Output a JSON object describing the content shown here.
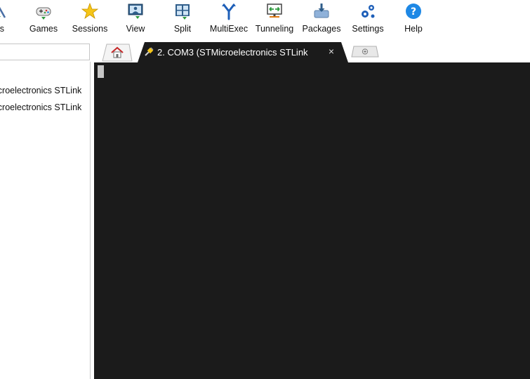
{
  "toolbar": {
    "items": [
      {
        "label": "ols",
        "icon": "tools-icon"
      },
      {
        "label": "Games",
        "icon": "gamepad-icon"
      },
      {
        "label": "Sessions",
        "icon": "star-icon"
      },
      {
        "label": "View",
        "icon": "view-icon"
      },
      {
        "label": "Split",
        "icon": "split-icon"
      },
      {
        "label": "MultiExec",
        "icon": "multiexec-icon"
      },
      {
        "label": "Tunneling",
        "icon": "tunneling-icon"
      },
      {
        "label": "Packages",
        "icon": "packages-icon"
      },
      {
        "label": "Settings",
        "icon": "gears-icon"
      },
      {
        "label": "Help",
        "icon": "help-icon"
      }
    ]
  },
  "sidebar": {
    "search": {
      "value": "",
      "placeholder": ""
    },
    "items": [
      {
        "label": "icroelectronics STLink"
      },
      {
        "label": "icroelectronics STLink"
      }
    ]
  },
  "tabs": {
    "home": {
      "icon": "home-icon"
    },
    "active": {
      "label": "2.  COM3   (STMicroelectronics STLink",
      "close": "×",
      "icon": "serial-plug-icon"
    },
    "new": {
      "icon": "plus-icon"
    }
  },
  "colors": {
    "terminal_bg": "#1b1b1b",
    "active_tab_bg": "#1b1b1b",
    "cursor": "#c6c6c6",
    "accent_blue": "#1e88e5"
  }
}
